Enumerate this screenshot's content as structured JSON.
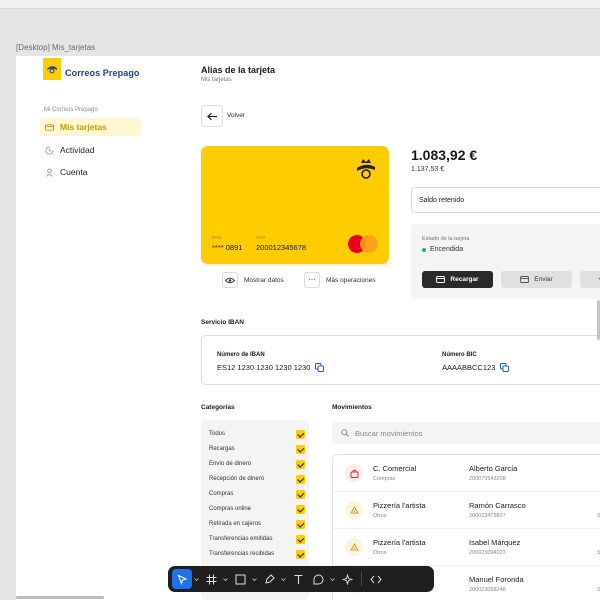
{
  "window": {
    "frame_label": "[Desktop] Mis_tarjetas"
  },
  "brand": {
    "name": "Correos Prepago",
    "color": "#ffcc00"
  },
  "sidebar": {
    "section": "Mi Correos Prepago",
    "items": [
      {
        "label": "Mis tarjetas",
        "icon": "card-icon",
        "active": true
      },
      {
        "label": "Actividad",
        "icon": "activity-icon",
        "active": false
      },
      {
        "label": "Cuenta",
        "icon": "user-icon",
        "active": false
      }
    ]
  },
  "header": {
    "title": "Alias de la tarjeta",
    "breadcrumb": "Mis tarjetas"
  },
  "back": {
    "label": "Volver"
  },
  "card": {
    "pan_label": "PAN",
    "pan": "**** 0891",
    "cvv_label": "CVV",
    "cvv": "200012345678",
    "brand_logo": "mastercard-logo"
  },
  "card_actions": {
    "show_data": "Mostrar datos",
    "more_ops": "Más operaciones"
  },
  "balance": {
    "main": "1.083,92 €",
    "secondary": "1.137,53 €",
    "retained_label": "Saldo retenido"
  },
  "card_state": {
    "label": "Estado de la tarjeta",
    "value": "Encendida",
    "status_color": "#1eb57a",
    "recharge": "Recargar",
    "send": "Enviar",
    "extra": "+"
  },
  "iban": {
    "title": "Servicio IBAN",
    "iban_label": "Número de IBAN",
    "iban_value": "ES12 1230 1230 1230 1230",
    "bic_label": "Número BIC",
    "bic_value": "AAAABBCC123"
  },
  "categories": {
    "title": "Categorías",
    "items": [
      "Todos",
      "Recargas",
      "Envío de dinero",
      "Recepción de dinero",
      "Compras",
      "Compras online",
      "Retirada en cajeros",
      "Transferencias emitidas",
      "Transferencias recibidas"
    ]
  },
  "movements": {
    "title": "Movimientos",
    "search_placeholder": "Buscar movimientos",
    "rows": [
      {
        "name": "C. Comercial",
        "category": "Compras",
        "person": "Alberto García",
        "ref": "200079543208",
        "extra": "",
        "icon": "bag-icon"
      },
      {
        "name": "Pizzería l'artista",
        "category": "Otros",
        "person": "Ramón Carrasco",
        "ref": "200023479827",
        "extra": "S",
        "icon": "food-icon"
      },
      {
        "name": "Pizzería l'artista",
        "category": "Otros",
        "person": "Isabel Márquez",
        "ref": "200023094023",
        "extra": "S",
        "icon": "food-icon"
      },
      {
        "name": "",
        "category": "",
        "person": "Manuel Foronda",
        "ref": "200023058248",
        "extra": "S",
        "icon": "food-icon"
      }
    ]
  },
  "toolbar": {
    "tools": [
      "move-icon",
      "frame-icon",
      "shape-icon",
      "pen-icon",
      "text-icon",
      "comment-icon",
      "actions-icon",
      "dev-mode-icon"
    ],
    "active_color": "#1e73e8"
  }
}
